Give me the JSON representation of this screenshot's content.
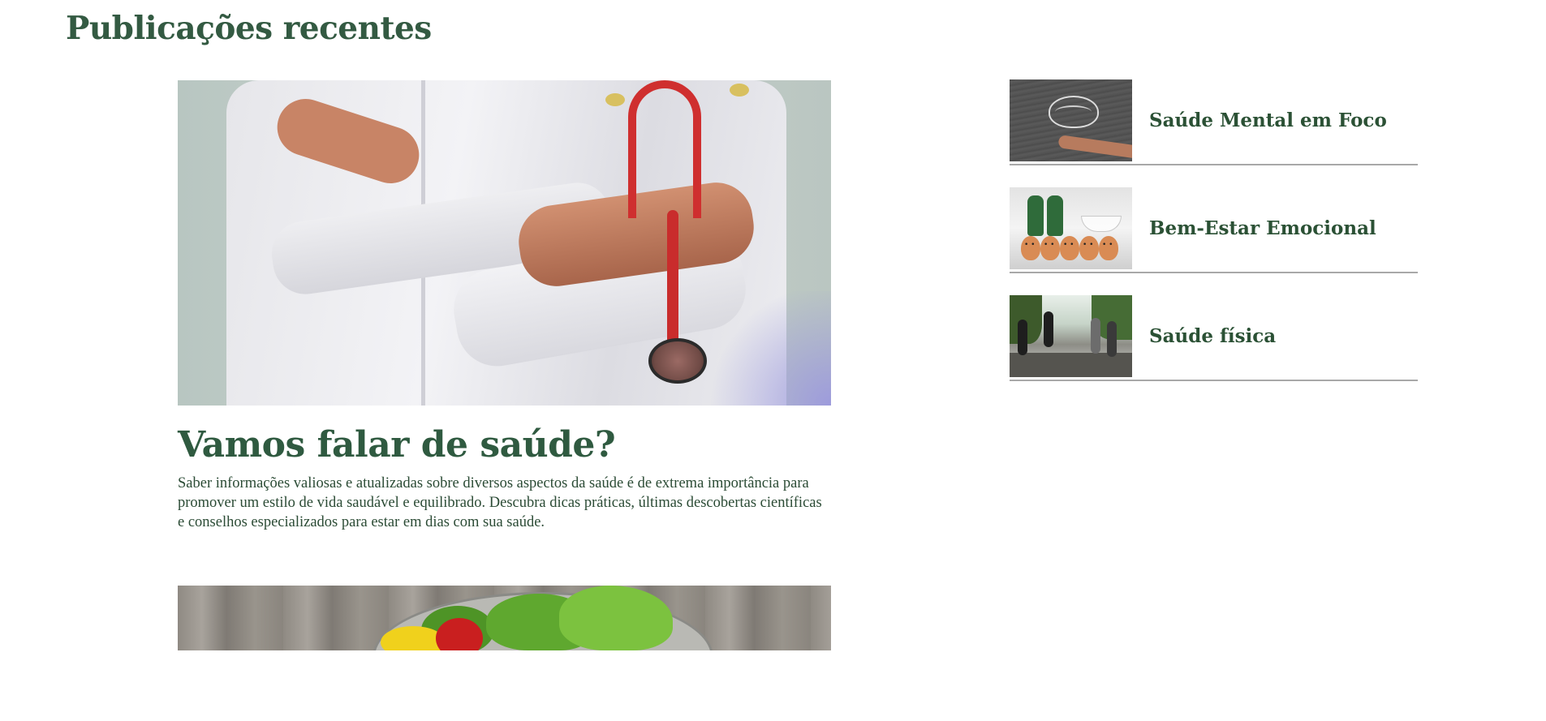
{
  "section": {
    "title": "Publicações recentes"
  },
  "featured": {
    "title": "Vamos falar de saúde?",
    "description": "Saber informações valiosas e atualizadas sobre diversos aspectos da saúde é de extrema importância para promover um estilo de vida saudável e equilibrado. Descubra dicas práticas, últimas descobertas científicas e conselhos especializados para estar em dias com sua saúde."
  },
  "sidebar": {
    "items": [
      {
        "title": "Saúde Mental em Foco"
      },
      {
        "title": "Bem-Estar Emocional"
      },
      {
        "title": "Saúde física"
      }
    ]
  },
  "colors": {
    "heading": "#335a42",
    "text": "#2b4b35",
    "divider": "#a8a8a8",
    "background": "#ffffff"
  }
}
